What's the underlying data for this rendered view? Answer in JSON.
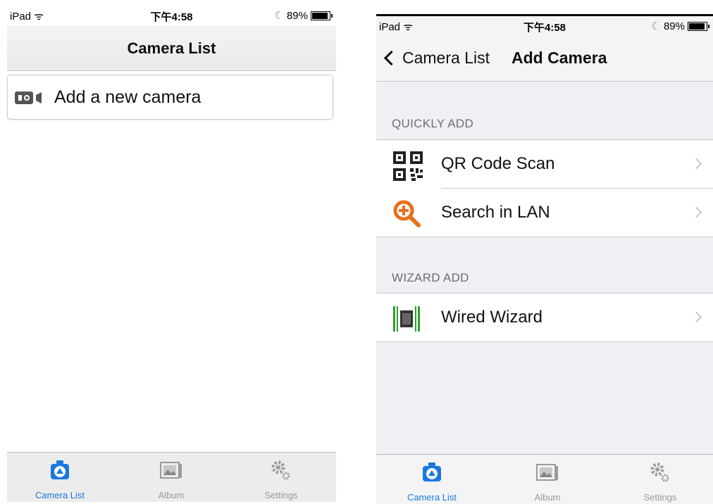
{
  "left": {
    "status": {
      "device": "iPad",
      "time": "下午4:58",
      "battery": "89%"
    },
    "title": "Camera List",
    "add_camera_label": "Add a new camera",
    "tabs": [
      {
        "label": "Camera List",
        "icon": "camera-icon",
        "active": true
      },
      {
        "label": "Album",
        "icon": "album-icon",
        "active": false
      },
      {
        "label": "Settings",
        "icon": "gear-icon",
        "active": false
      }
    ]
  },
  "right": {
    "status": {
      "device": "iPad",
      "time": "下午4:58",
      "battery": "89%"
    },
    "back_label": "Camera List",
    "title": "Add Camera",
    "sections": [
      {
        "header": "QUICKLY ADD",
        "items": [
          {
            "label": "QR Code Scan",
            "icon": "qr-code-icon"
          },
          {
            "label": "Search in LAN",
            "icon": "search-plus-icon"
          }
        ]
      },
      {
        "header": "WIZARD ADD",
        "items": [
          {
            "label": "Wired Wizard",
            "icon": "wired-wizard-icon"
          }
        ]
      }
    ],
    "tabs": [
      {
        "label": "Camera List",
        "icon": "camera-icon",
        "active": true
      },
      {
        "label": "Album",
        "icon": "album-icon",
        "active": false
      },
      {
        "label": "Settings",
        "icon": "gear-icon",
        "active": false
      }
    ]
  },
  "colors": {
    "accent": "#1a78e0",
    "search_orange": "#e8701a",
    "wizard_green": "#2ca02c"
  }
}
